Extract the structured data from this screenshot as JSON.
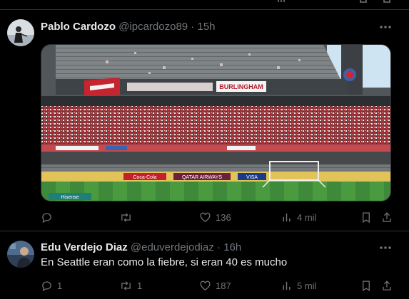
{
  "tweets": [
    {
      "name": "Pablo Cardozo",
      "handle": "@ipcardozo89",
      "time": "15h",
      "text": "",
      "stats": {
        "replies": "",
        "reposts": "",
        "likes": "136",
        "views": "4 mil"
      }
    },
    {
      "name": "Edu Verdejo Diaz",
      "handle": "@eduverdejodiaz",
      "time": "16h",
      "text": "En Seattle eran como la fiebre, si eran 40 es mucho",
      "stats": {
        "replies": "1",
        "reposts": "1",
        "likes": "187",
        "views": "5 mil"
      }
    }
  ],
  "separator": " · ",
  "media_banners": {
    "stand_banner": "BURLINGHAM",
    "sponsor_1": "QATAR AIRWAYS",
    "sponsor_2": "Coca-Cola",
    "sponsor_3": "VISA",
    "sponsor_4": "Hisense"
  },
  "icons": [
    "more-icon",
    "reply-icon",
    "repost-icon",
    "like-icon",
    "views-icon",
    "bookmark-icon",
    "share-icon"
  ],
  "colors": {
    "background": "#000000",
    "text": "#e7e9ea",
    "muted": "#71767b",
    "border": "#2f3336"
  }
}
